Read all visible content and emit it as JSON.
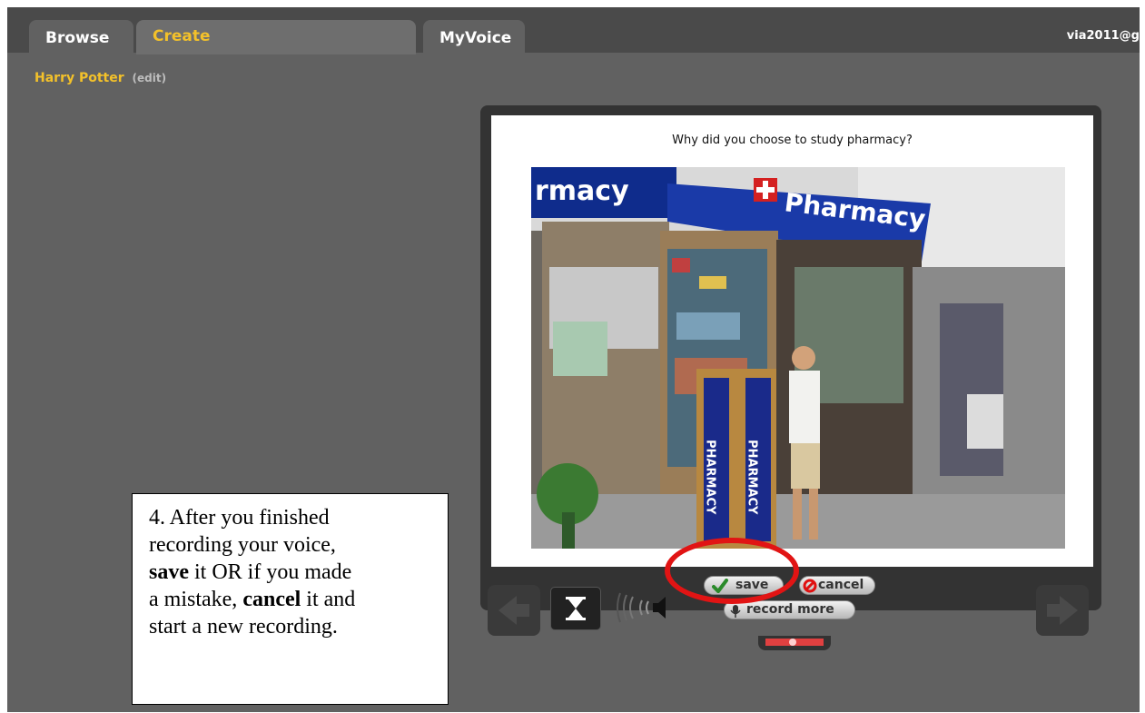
{
  "tabs": [
    {
      "label": "Browse",
      "active": false
    },
    {
      "label": "Create",
      "active": true
    },
    {
      "label": "MyVoice",
      "active": false
    }
  ],
  "user": {
    "email": "via2011@g"
  },
  "breadcrumb": {
    "title": "Harry Potter",
    "edit": "(edit)"
  },
  "slide": {
    "question": "Why did you choose to study pharmacy?",
    "signs": {
      "left": "rmacy",
      "main": "Pharmacy",
      "pillar": "PHARMACY"
    }
  },
  "controls": {
    "save": "save",
    "cancel": "cancel",
    "record_more": "record more"
  },
  "callout": {
    "line1": "4. After you finished",
    "line2": "recording your voice,",
    "save_word": "save",
    "line3_rest": " it OR if you made",
    "line4": "a mistake, ",
    "cancel_word": "cancel",
    "line5_rest": " it and",
    "line6": "start a new recording."
  },
  "colors": {
    "accent": "#f3c12a",
    "highlight": "#e11414",
    "background": "#616161"
  },
  "icons": [
    "prev-arrow-icon",
    "next-arrow-icon",
    "hourglass-icon",
    "speaker-icon",
    "check-icon",
    "cancel-circle-icon",
    "microphone-icon"
  ]
}
